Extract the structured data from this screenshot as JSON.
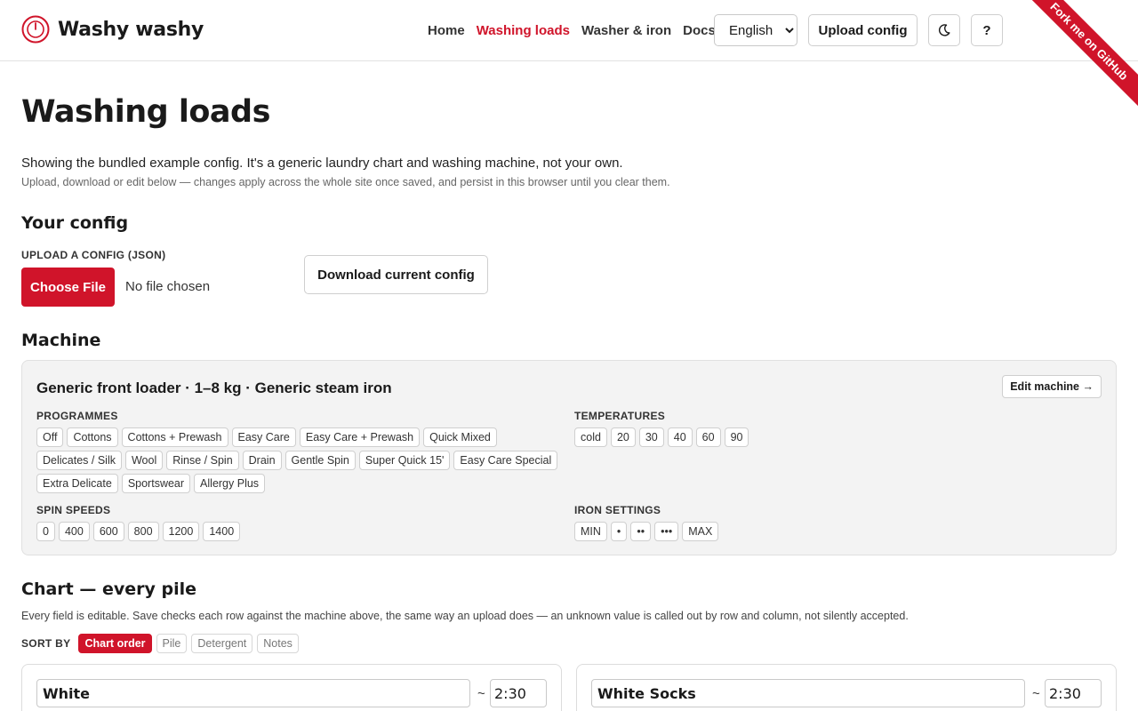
{
  "brand": {
    "name": "Washy washy"
  },
  "nav": {
    "home": "Home",
    "washing_loads": "Washing loads",
    "washer_iron": "Washer & iron",
    "docs": "Docs"
  },
  "language": {
    "selected": "English"
  },
  "header": {
    "upload_config": "Upload config",
    "theme_icon": "moon-icon",
    "help": "?"
  },
  "ribbon": {
    "text": "Fork me on GitHub"
  },
  "page": {
    "title": "Washing loads",
    "intro": "Showing the bundled example config. It's a generic laundry chart and washing machine, not your own.",
    "intro_sub": "Upload, download or edit below — changes apply across the whole site once saved, and persist in this browser until you clear them."
  },
  "config": {
    "heading": "Your config",
    "upload_label": "UPLOAD A CONFIG (JSON)",
    "choose_file": "Choose File",
    "no_file": "No file chosen",
    "download": "Download current config"
  },
  "machine": {
    "heading": "Machine",
    "name": "Generic front loader · 1–8 kg · Generic steam iron",
    "edit": "Edit machine →",
    "programmes_label": "PROGRAMMES",
    "programmes": [
      "Off",
      "Cottons",
      "Cottons + Prewash",
      "Easy Care",
      "Easy Care + Prewash",
      "Quick Mixed",
      "Delicates / Silk",
      "Wool",
      "Rinse / Spin",
      "Drain",
      "Gentle Spin",
      "Super Quick 15'",
      "Easy Care Special",
      "Extra Delicate",
      "Sportswear",
      "Allergy Plus"
    ],
    "temperatures_label": "TEMPERATURES",
    "temperatures": [
      "cold",
      "20",
      "30",
      "40",
      "60",
      "90"
    ],
    "spin_label": "SPIN SPEEDS",
    "spin_speeds": [
      "0",
      "400",
      "600",
      "800",
      "1200",
      "1400"
    ],
    "iron_label": "IRON SETTINGS",
    "iron_settings": [
      "MIN",
      "•",
      "••",
      "•••",
      "MAX"
    ]
  },
  "chart": {
    "heading": "Chart — every pile",
    "description": "Every field is editable. Save checks each row against the machine above, the same way an upload does — an unknown value is called out by row and column, not silently accepted.",
    "sort_label": "SORT BY",
    "sort_options": [
      "Chart order",
      "Pile",
      "Detergent",
      "Notes"
    ],
    "sort_active": 0,
    "piles": [
      {
        "name": "White",
        "approx": "~",
        "time": "2:30"
      },
      {
        "name": "White Socks",
        "approx": "~",
        "time": "2:30"
      }
    ]
  },
  "colors": {
    "accent": "#d0142a",
    "card_bg": "#f3f3f3",
    "border": "#dcdcdc"
  }
}
